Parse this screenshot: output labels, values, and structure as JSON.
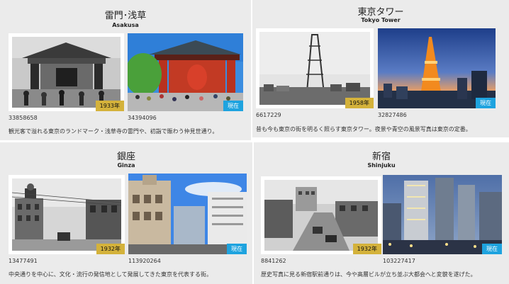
{
  "cards": [
    {
      "title_jp": "雷門･浅草",
      "title_en": "Asakusa",
      "old_photo": {
        "id": "33858658",
        "badge": "1933年"
      },
      "new_photo": {
        "id": "34394096",
        "badge": "現在"
      },
      "caption": "観光客で溢れる東京のランドマーク・浅草寺の雷門や、初詣で賑わう仲見世通り。"
    },
    {
      "title_jp": "東京タワー",
      "title_en": "Tokyo Tower",
      "old_photo": {
        "id": "6617229",
        "badge": "1958年"
      },
      "new_photo": {
        "id": "32827486",
        "badge": "現在"
      },
      "caption": "昔も今も東京の街を明るく照らす東京タワー。夜景や青空の風景写真は東京の定番。"
    },
    {
      "title_jp": "銀座",
      "title_en": "Ginza",
      "old_photo": {
        "id": "13477491",
        "badge": "1932年"
      },
      "new_photo": {
        "id": "113920264",
        "badge": "現在"
      },
      "caption": "中央通りを中心に、文化・流行の発信地として発展してきた東京を代表する街。"
    },
    {
      "title_jp": "新宿",
      "title_en": "Shinjuku",
      "old_photo": {
        "id": "8841262",
        "badge": "1932年"
      },
      "new_photo": {
        "id": "103227417",
        "badge": "現在"
      },
      "caption": "歴史写真に見る新宿駅前通りは、今や高層ビルが立ち並ぶ大都会へと変貌を遂げた。"
    }
  ]
}
